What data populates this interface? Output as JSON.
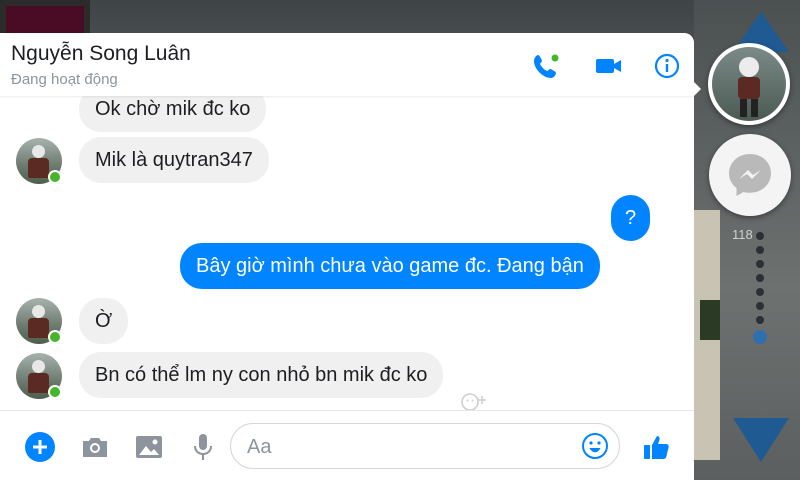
{
  "contact": {
    "name": "Nguyễn Song Luân",
    "status": "Đang hoạt động"
  },
  "header_icons": [
    "phone-icon",
    "video-camera-icon",
    "info-icon"
  ],
  "messages": [
    {
      "dir": "in",
      "text": "Ok chờ mik đc ko",
      "avatar": false
    },
    {
      "dir": "in",
      "text": "Mik là quytran347",
      "avatar": true
    },
    {
      "dir": "out",
      "text": "?"
    },
    {
      "dir": "out",
      "text": "Bây giờ mình chưa vào game đc. Đang bận"
    },
    {
      "dir": "in",
      "text": "Ờ",
      "avatar": true
    },
    {
      "dir": "in",
      "text": "Bn có thể lm ny con nhỏ bn mik đc ko",
      "avatar": true
    }
  ],
  "composer": {
    "placeholder": "Aa",
    "icons": [
      "add-icon",
      "camera-icon",
      "image-icon",
      "microphone-icon",
      "emoji-icon",
      "like-thumb-icon"
    ]
  },
  "overlay": {
    "count": "118"
  },
  "colors": {
    "accent": "#0084ff",
    "incoming_bubble": "#f1f0f0",
    "online": "#42b72a",
    "scroll_arrow": "#1f5a93"
  }
}
